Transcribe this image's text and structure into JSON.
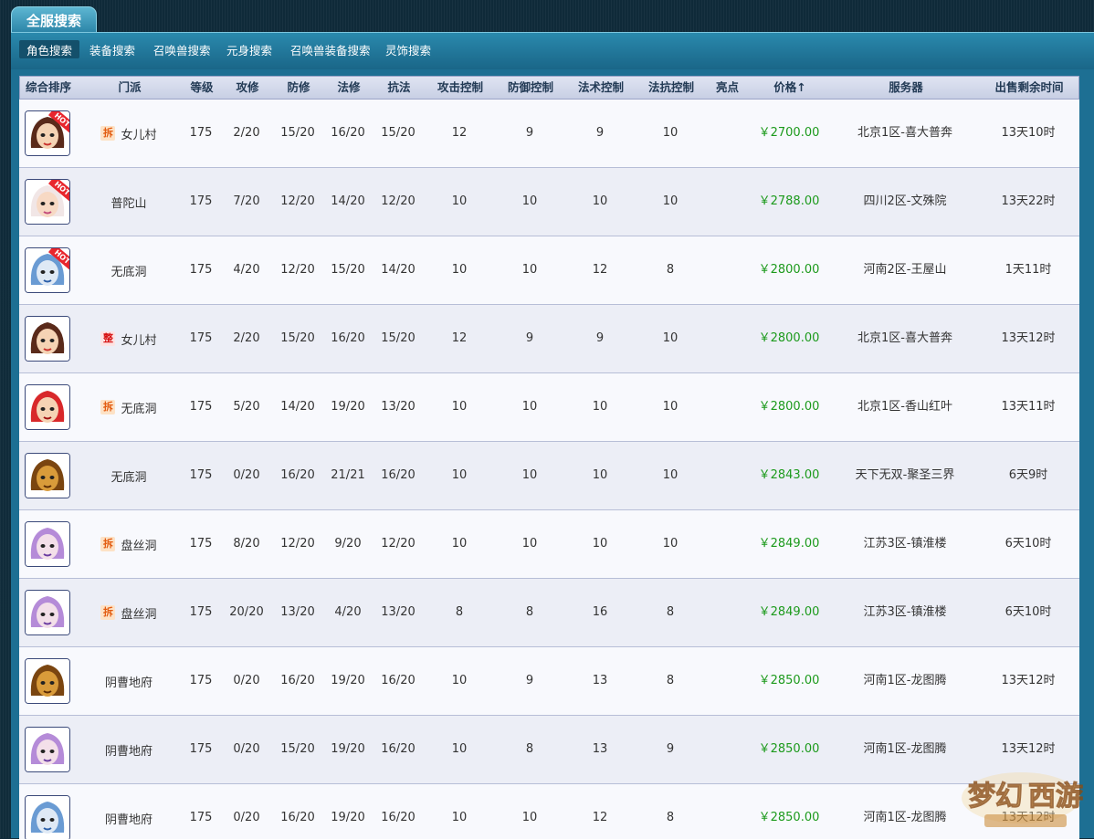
{
  "top_tab": "全服搜索",
  "subnav": [
    {
      "label": "角色搜索",
      "active": true
    },
    {
      "label": "装备搜索",
      "active": false
    },
    {
      "label": "召唤兽搜索",
      "active": false
    },
    {
      "label": "元身搜索",
      "active": false
    },
    {
      "label": "召唤兽装备搜索",
      "active": false
    },
    {
      "label": "灵饰搜索",
      "active": false
    }
  ],
  "columns": {
    "rank": "综合排序",
    "school": "门派",
    "level": "等级",
    "attack": "攻修",
    "defense": "防修",
    "magic": "法修",
    "resist": "抗法",
    "atk_ctrl": "攻击控制",
    "def_ctrl": "防御控制",
    "mag_ctrl": "法术控制",
    "res_ctrl": "法抗控制",
    "highlight": "亮点",
    "price": "价格",
    "price_sort_arrow": "↑",
    "server": "服务器",
    "time_left": "出售剩余时间"
  },
  "rows": [
    {
      "avatar": "avatar-girl-red-icon",
      "hot": "HOT",
      "badge": "拆",
      "badge_type": "chai",
      "school": "女儿村",
      "level": "175",
      "attack": "2/20",
      "defense": "15/20",
      "magic": "16/20",
      "resist": "15/20",
      "atk_ctrl": "12",
      "def_ctrl": "9",
      "mag_ctrl": "9",
      "res_ctrl": "10",
      "price": "￥2700.00",
      "server": "北京1区-喜大普奔",
      "time": "13天10时"
    },
    {
      "avatar": "avatar-girl-pink-icon",
      "hot": "HOT",
      "badge": "",
      "badge_type": "",
      "school": "普陀山",
      "level": "175",
      "attack": "7/20",
      "defense": "12/20",
      "magic": "14/20",
      "resist": "12/20",
      "atk_ctrl": "10",
      "def_ctrl": "10",
      "mag_ctrl": "10",
      "res_ctrl": "10",
      "price": "￥2788.00",
      "server": "四川2区-文殊院",
      "time": "13天22时"
    },
    {
      "avatar": "avatar-girl-blue-icon",
      "hot": "HOT",
      "badge": "",
      "badge_type": "",
      "school": "无底洞",
      "level": "175",
      "attack": "4/20",
      "defense": "12/20",
      "magic": "15/20",
      "resist": "14/20",
      "atk_ctrl": "10",
      "def_ctrl": "10",
      "mag_ctrl": "12",
      "res_ctrl": "8",
      "price": "￥2800.00",
      "server": "河南2区-王屋山",
      "time": "1天11时"
    },
    {
      "avatar": "avatar-girl-red-icon",
      "hot": "",
      "badge": "整",
      "badge_type": "zheng",
      "school": "女儿村",
      "level": "175",
      "attack": "2/20",
      "defense": "15/20",
      "magic": "16/20",
      "resist": "15/20",
      "atk_ctrl": "12",
      "def_ctrl": "9",
      "mag_ctrl": "9",
      "res_ctrl": "10",
      "price": "￥2800.00",
      "server": "北京1区-喜大普奔",
      "time": "13天12时"
    },
    {
      "avatar": "avatar-girl-redhair-icon",
      "hot": "",
      "badge": "拆",
      "badge_type": "chai",
      "school": "无底洞",
      "level": "175",
      "attack": "5/20",
      "defense": "14/20",
      "magic": "19/20",
      "resist": "13/20",
      "atk_ctrl": "10",
      "def_ctrl": "10",
      "mag_ctrl": "10",
      "res_ctrl": "10",
      "price": "￥2800.00",
      "server": "北京1区-香山红叶",
      "time": "13天11时"
    },
    {
      "avatar": "avatar-tiger-icon",
      "hot": "",
      "badge": "",
      "badge_type": "",
      "school": "无底洞",
      "level": "175",
      "attack": "0/20",
      "defense": "16/20",
      "magic": "21/21",
      "resist": "16/20",
      "atk_ctrl": "10",
      "def_ctrl": "10",
      "mag_ctrl": "10",
      "res_ctrl": "10",
      "price": "￥2843.00",
      "server": "天下无双-聚圣三界",
      "time": "6天9时"
    },
    {
      "avatar": "avatar-girl-purple-icon",
      "hot": "",
      "badge": "拆",
      "badge_type": "chai",
      "school": "盘丝洞",
      "level": "175",
      "attack": "8/20",
      "defense": "12/20",
      "magic": "9/20",
      "resist": "12/20",
      "atk_ctrl": "10",
      "def_ctrl": "10",
      "mag_ctrl": "10",
      "res_ctrl": "10",
      "price": "￥2849.00",
      "server": "江苏3区-镇淮楼",
      "time": "6天10时"
    },
    {
      "avatar": "avatar-girl-purple-icon",
      "hot": "",
      "badge": "拆",
      "badge_type": "chai",
      "school": "盘丝洞",
      "level": "175",
      "attack": "20/20",
      "defense": "13/20",
      "magic": "4/20",
      "resist": "13/20",
      "atk_ctrl": "8",
      "def_ctrl": "8",
      "mag_ctrl": "16",
      "res_ctrl": "8",
      "price": "￥2849.00",
      "server": "江苏3区-镇淮楼",
      "time": "6天10时"
    },
    {
      "avatar": "avatar-tiger-icon",
      "hot": "",
      "badge": "",
      "badge_type": "",
      "school": "阴曹地府",
      "level": "175",
      "attack": "0/20",
      "defense": "16/20",
      "magic": "19/20",
      "resist": "16/20",
      "atk_ctrl": "10",
      "def_ctrl": "9",
      "mag_ctrl": "13",
      "res_ctrl": "8",
      "price": "￥2850.00",
      "server": "河南1区-龙图腾",
      "time": "13天12时"
    },
    {
      "avatar": "avatar-girl-purple-icon",
      "hot": "",
      "badge": "",
      "badge_type": "",
      "school": "阴曹地府",
      "level": "175",
      "attack": "0/20",
      "defense": "15/20",
      "magic": "19/20",
      "resist": "16/20",
      "atk_ctrl": "10",
      "def_ctrl": "8",
      "mag_ctrl": "13",
      "res_ctrl": "9",
      "price": "￥2850.00",
      "server": "河南1区-龙图腾",
      "time": "13天12时"
    },
    {
      "avatar": "avatar-girl-blue-icon",
      "hot": "",
      "badge": "",
      "badge_type": "",
      "school": "阴曹地府",
      "level": "175",
      "attack": "0/20",
      "defense": "16/20",
      "magic": "19/20",
      "resist": "16/20",
      "atk_ctrl": "10",
      "def_ctrl": "10",
      "mag_ctrl": "12",
      "res_ctrl": "8",
      "price": "￥2850.00",
      "server": "河南1区-龙图腾",
      "time": "13天12时"
    }
  ],
  "colors": {
    "price": "#1c9a1c",
    "header_text": "#223a55",
    "panel": "#1d6f93",
    "badge_chai": "#e25b10",
    "badge_zheng": "#d60f0f"
  },
  "watermark_icon": "game-logo-watermark-icon"
}
